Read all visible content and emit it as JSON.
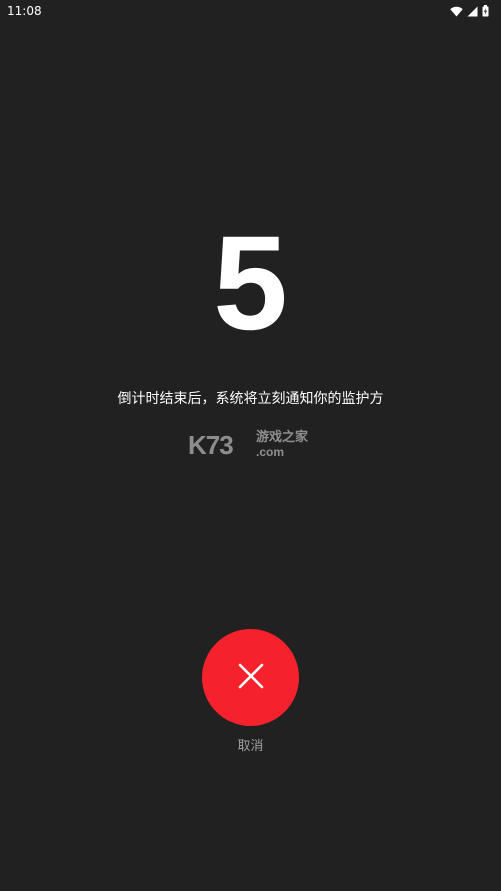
{
  "status_bar": {
    "time": "11:08",
    "icons": [
      "wifi-icon",
      "cellular-signal-icon",
      "battery-icon"
    ]
  },
  "countdown": {
    "value": "5"
  },
  "message": "倒计时结束后，系统将立刻通知你的监护方",
  "watermark": {
    "logo": "K73",
    "name": "游戏之家",
    "domain": ".com"
  },
  "cancel": {
    "label": "取消",
    "icon": "close-icon"
  },
  "colors": {
    "background": "#212121",
    "cancel_button": "#f5222d",
    "label_gray": "#9e9e9e"
  }
}
